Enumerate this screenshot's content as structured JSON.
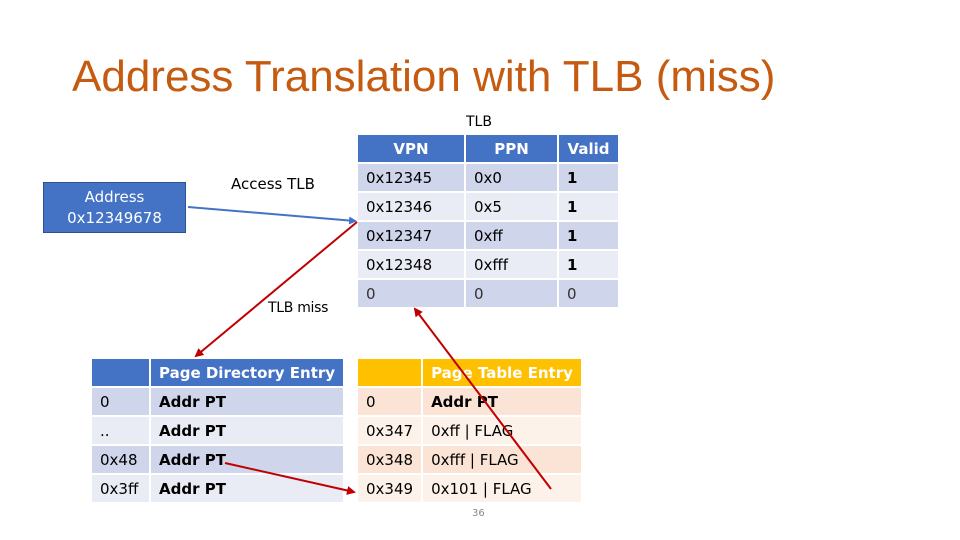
{
  "title": "Address Translation with TLB (miss)",
  "address_box": {
    "line1": "Address",
    "line2": "0x12349678"
  },
  "labels": {
    "tlb_caption": "TLB",
    "access_tlb": "Access TLB",
    "tlb_miss": "TLB miss"
  },
  "tlb": {
    "headers": [
      "VPN",
      "PPN",
      "Valid"
    ],
    "rows": [
      [
        "0x12345",
        "0x0",
        "1"
      ],
      [
        "0x12346",
        "0x5",
        "1"
      ],
      [
        "0x12347",
        "0xff",
        "1"
      ],
      [
        "0x12348",
        "0xfff",
        "1"
      ],
      [
        "0",
        "0",
        "0"
      ]
    ]
  },
  "page_directory": {
    "headers": [
      "",
      "Page Directory Entry"
    ],
    "rows": [
      [
        "0",
        "Addr PT"
      ],
      [
        "..",
        "Addr PT"
      ],
      [
        "0x48",
        "Addr PT"
      ],
      [
        "0x3ff",
        "Addr PT"
      ]
    ]
  },
  "page_table": {
    "headers": [
      "",
      "Page Table Entry"
    ],
    "rows": [
      [
        "0",
        "Addr PT"
      ],
      [
        "0x347",
        "0xff | FLAG"
      ],
      [
        "0x348",
        "0xfff | FLAG"
      ],
      [
        "0x349",
        "0x101 | FLAG"
      ]
    ]
  },
  "colors": {
    "title": "#c55a11",
    "blue": "#4472c4",
    "gold": "#ffc000",
    "arrow_red": "#c00000",
    "arrow_blue": "#4472c4"
  },
  "slide_number": "36"
}
